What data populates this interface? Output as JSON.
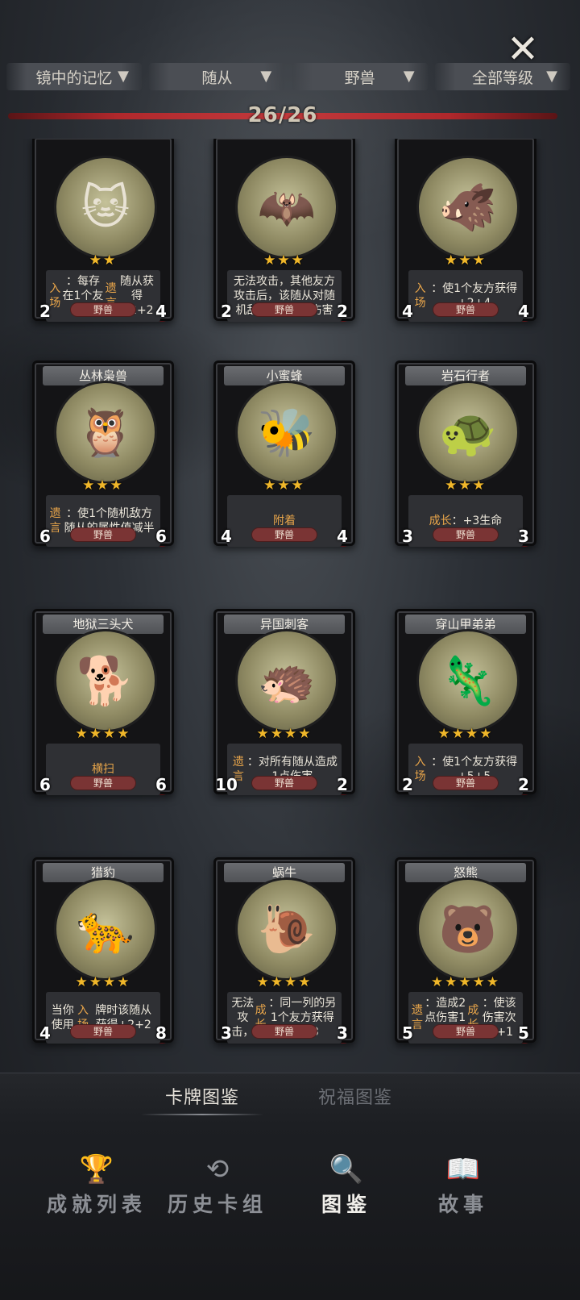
{
  "filters": [
    {
      "label": "镜中的记忆"
    },
    {
      "label": "随从"
    },
    {
      "label": "野兽"
    },
    {
      "label": "全部等级"
    }
  ],
  "progress": {
    "count": "26/26",
    "fraction": 1.0
  },
  "cards": [
    {
      "name": "",
      "icon": "🐱",
      "stars": 2,
      "desc_html": "<span class='kw'>入场</span>：每存在1个友方<span class='kw'>遗言</span>随从获得+2+2",
      "atk": "2",
      "hp": "4",
      "type": "野兽"
    },
    {
      "name": "",
      "icon": "🦇",
      "stars": 3,
      "desc_html": "无法攻击，其他友方攻击后，该随从对随机敌方造成3点伤害",
      "atk": "2",
      "hp": "2",
      "type": "野兽"
    },
    {
      "name": "",
      "icon": "🐗",
      "stars": 3,
      "desc_html": "<span class='kw'>入场</span>：使1个友方获得+2+4",
      "atk": "4",
      "hp": "4",
      "type": "野兽"
    },
    {
      "name": "丛林枭兽",
      "icon": "🦉",
      "stars": 3,
      "desc_html": "<span class='kw'>遗言</span>：使1个随机敌方随从的属性值减半",
      "atk": "6",
      "hp": "6",
      "type": "野兽"
    },
    {
      "name": "小蜜蜂",
      "icon": "🐝",
      "stars": 3,
      "desc_html": "<span class='kw'>附着</span>",
      "atk": "4",
      "hp": "4",
      "type": "野兽"
    },
    {
      "name": "岩石行者",
      "icon": "🐢",
      "stars": 3,
      "desc_html": "<span class='kw'>成长</span>：+3生命",
      "atk": "3",
      "hp": "3",
      "type": "野兽"
    },
    {
      "name": "地狱三头犬",
      "icon": "🐕",
      "stars": 4,
      "desc_html": "<span class='kw'>横扫</span>",
      "atk": "6",
      "hp": "6",
      "type": "野兽"
    },
    {
      "name": "异国刺客",
      "icon": "🦔",
      "stars": 4,
      "desc_html": "<span class='kw'>遗言</span>：对所有随从造成1点伤害",
      "atk": "10",
      "hp": "2",
      "type": "野兽"
    },
    {
      "name": "穿山甲弟弟",
      "icon": "🦎",
      "stars": 4,
      "desc_html": "<span class='kw'>入场</span>：使1个友方获得+5+5",
      "atk": "2",
      "hp": "2",
      "type": "野兽"
    },
    {
      "name": "猎豹",
      "icon": "🐆",
      "stars": 4,
      "desc_html": "当你使用<span class='kw'>入场</span>牌时该随从获得+2+2",
      "atk": "4",
      "hp": "8",
      "type": "野兽"
    },
    {
      "name": "蜗牛",
      "icon": "🐌",
      "stars": 4,
      "desc_html": "无法攻击，<span class='kw'>成长</span>：同一列的另1个友方获得+3+3",
      "atk": "3",
      "hp": "3",
      "type": "野兽"
    },
    {
      "name": "怒熊",
      "icon": "🐻",
      "stars": 5,
      "desc_html": "<span class='kw'>遗言</span>：造成2点伤害1次。<span class='kw'>成长</span>：使该伤害次数+1",
      "atk": "5",
      "hp": "5",
      "type": "野兽"
    }
  ],
  "tabs": {
    "active": "卡牌图鉴",
    "inactive": "祝福图鉴"
  },
  "nav": [
    {
      "icon": "trophy-icon",
      "glyph": "🏆",
      "label": "成就列表",
      "active": false
    },
    {
      "icon": "history-icon",
      "glyph": "⟲",
      "label": "历史卡组",
      "active": false
    },
    {
      "icon": "magnifier-icon",
      "glyph": "🔍",
      "label": "图鉴",
      "active": true
    },
    {
      "icon": "story-book-icon",
      "glyph": "📖",
      "label": "故事",
      "active": false
    }
  ],
  "close_glyph": "✕"
}
